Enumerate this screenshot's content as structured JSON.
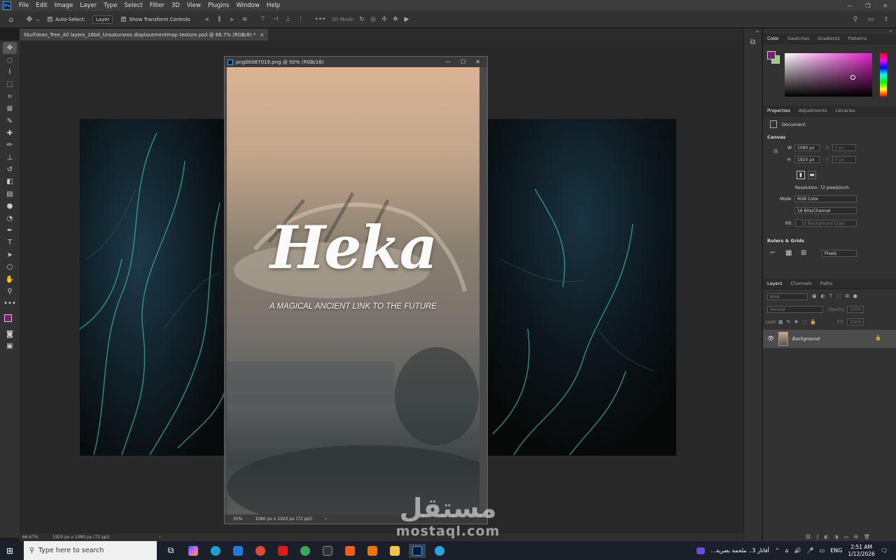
{
  "app": {
    "logo": "Ps"
  },
  "menu": [
    "File",
    "Edit",
    "Image",
    "Layer",
    "Type",
    "Select",
    "Filter",
    "3D",
    "View",
    "Plugins",
    "Window",
    "Help"
  ],
  "window_controls": {
    "minimize": "—",
    "restore": "❐",
    "close": "✕"
  },
  "options": {
    "auto_select_label": "Auto-Select:",
    "auto_select_value": "Layer",
    "show_transform_label": "Show Transform Controls",
    "mode_3d_label": "3D Mode:"
  },
  "document_tab": {
    "title": "SkullVean_Tree_All layers_16bit_Unsaturares displacementmap texture.psd @ 66.7% (RGB/8) *",
    "close": "×"
  },
  "float_window": {
    "title": "png00087019.png @ 50% (RGB/16)",
    "heading": "Heka",
    "tagline": "A MAGICAL ANCIENT LINK TO THE FUTURE",
    "zoom": "50%",
    "dimensions": "1080 px x 1920 px (72 ppi)",
    "arrow": "›"
  },
  "status": {
    "zoom": "66.67%",
    "dimensions": "1920 px x 1080 px (72 ppi)",
    "arrow": "›"
  },
  "color_panel": {
    "tabs": [
      "Color",
      "Swatches",
      "Gradients",
      "Patterns"
    ],
    "foreground": "#7a1f6e",
    "background": "#8fd07a"
  },
  "properties": {
    "tabs": [
      "Properties",
      "Adjustments",
      "Libraries"
    ],
    "type": "Document",
    "canvas_label": "Canvas",
    "w_label": "W",
    "w_value": "1080 px",
    "h_label": "H",
    "h_value": "1920 px",
    "x_label": "X",
    "x_value": "0 px",
    "y_label": "Y",
    "y_value": "0 px",
    "resolution": "Resolution: 72 pixels/inch",
    "mode_label": "Mode",
    "mode_value": "RGB Color",
    "depth_value": "16 Bits/Channel",
    "fill_label": "Fill",
    "fill_value": "Background Color",
    "rulers_label": "Rulers & Grids",
    "units_value": "Pixels"
  },
  "layers": {
    "tabs": [
      "Layers",
      "Channels",
      "Paths"
    ],
    "kind": "Kind",
    "blend": "Normal",
    "opacity_label": "Opacity:",
    "opacity_value": "100%",
    "lock_label": "Lock:",
    "fill_label": "Fill:",
    "fill_value": "100%",
    "items": [
      {
        "name": "Background"
      }
    ]
  },
  "taskbar": {
    "search_placeholder": "Type here to search",
    "notification": "أفاتار 3.. ملحمة بصرية...",
    "lang": "ENG",
    "time": "2:51 AM",
    "date": "1/12/2026"
  },
  "watermark": {
    "arabic": "مستقل",
    "latin": "mostaql.com"
  }
}
